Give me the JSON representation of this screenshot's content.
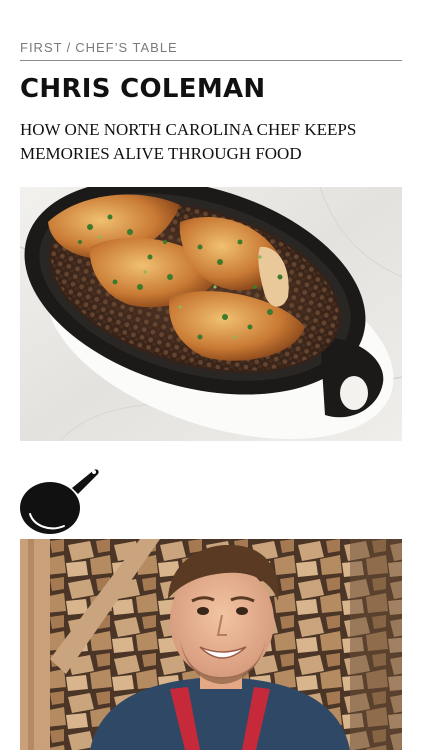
{
  "header": {
    "section": "FIRST",
    "separator": "/",
    "column": "CHEF’S TABLE"
  },
  "article": {
    "title": "CHRIS COLEMAN",
    "subtitle": "HOW ONE NORTH CAROLINA CHEF KEEPS MEMORIES ALIVE THROUGH FOOD"
  },
  "images": {
    "hero": "cast-iron-dish-photo",
    "icon": "skillet-icon",
    "portrait": "chef-portrait-photo"
  },
  "colors": {
    "text": "#111111",
    "muted": "#7a7a7a",
    "rule": "#8a8a8a",
    "icon": "#111111"
  }
}
